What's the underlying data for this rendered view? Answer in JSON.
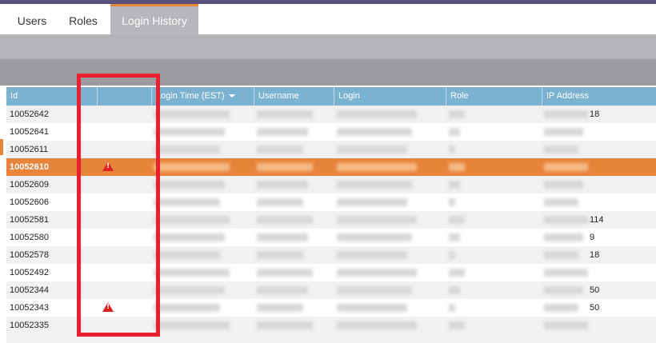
{
  "tabs": [
    {
      "label": "Users"
    },
    {
      "label": "Roles"
    },
    {
      "label": "Login History",
      "active": true
    }
  ],
  "table": {
    "columns": [
      {
        "label": "Id"
      },
      {
        "label": ""
      },
      {
        "label": "Login Time (EST)",
        "sorted": "descending"
      },
      {
        "label": "Username"
      },
      {
        "label": "Login"
      },
      {
        "label": "Role"
      },
      {
        "label": "IP Address"
      }
    ],
    "rows": [
      {
        "id": "10052642",
        "warning": false,
        "ip_visible": "18"
      },
      {
        "id": "10052641",
        "warning": false,
        "ip_visible": ""
      },
      {
        "id": "10052611",
        "warning": false,
        "ip_visible": ""
      },
      {
        "id": "10052610",
        "warning": true,
        "selected": true,
        "ip_visible": ""
      },
      {
        "id": "10052609",
        "warning": false,
        "ip_visible": ""
      },
      {
        "id": "10052606",
        "warning": false,
        "ip_visible": ""
      },
      {
        "id": "10052581",
        "warning": false,
        "ip_visible": "114"
      },
      {
        "id": "10052580",
        "warning": false,
        "ip_visible": "9"
      },
      {
        "id": "10052578",
        "warning": false,
        "ip_visible": "18"
      },
      {
        "id": "10052492",
        "warning": false,
        "ip_visible": ""
      },
      {
        "id": "10052344",
        "warning": false,
        "ip_visible": "50"
      },
      {
        "id": "10052343",
        "warning": true,
        "ip_visible": "50"
      },
      {
        "id": "10052335",
        "warning": false,
        "ip_visible": ""
      }
    ]
  },
  "colors": {
    "accent": "#e8833a",
    "header": "#7ab2d0",
    "warning": "#d9231f",
    "highlight_box": "#e8202f"
  }
}
